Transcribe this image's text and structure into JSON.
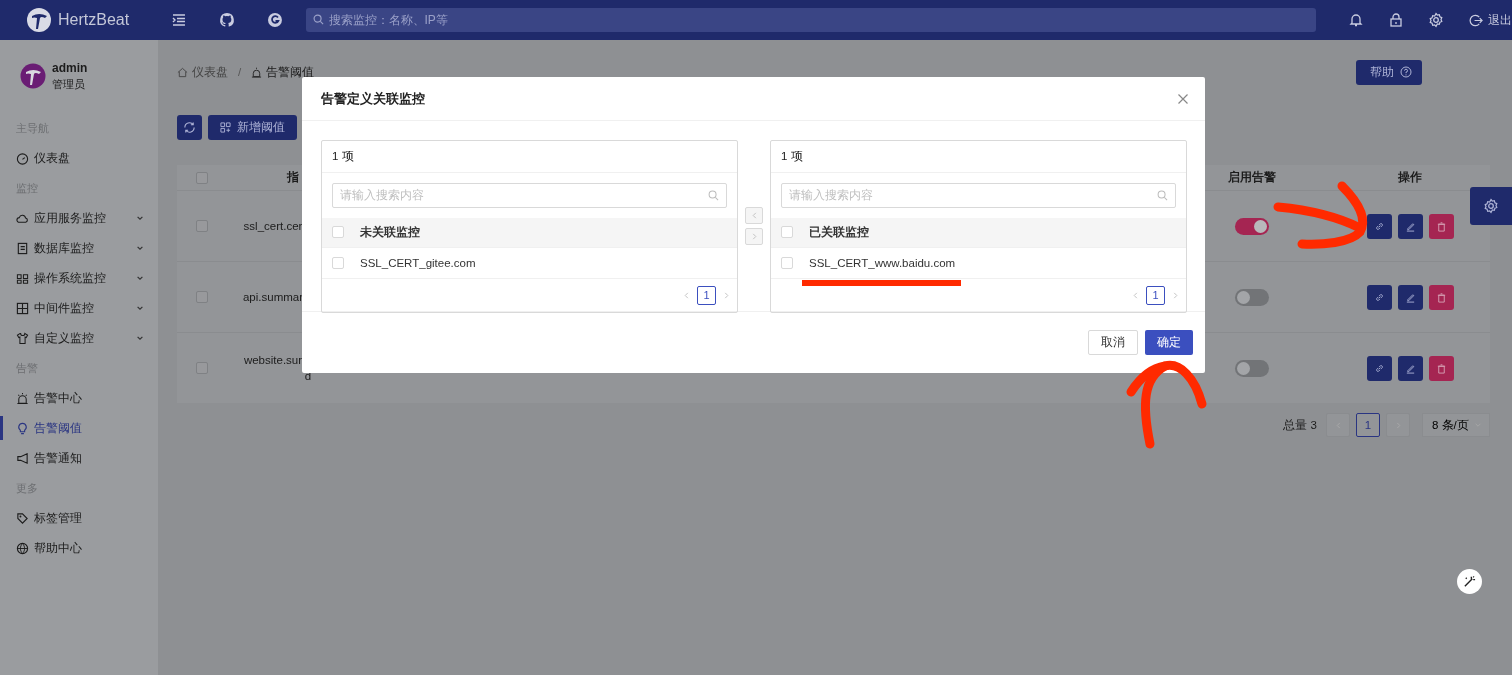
{
  "header": {
    "brand": "HertzBeat",
    "search_placeholder": "搜索监控：名称、IP等",
    "logout": "退出"
  },
  "user": {
    "name": "admin",
    "role": "管理员"
  },
  "sidebar": {
    "groups": [
      {
        "title": "主导航",
        "items": [
          {
            "label": "仪表盘",
            "expandable": false,
            "selected": false
          }
        ]
      },
      {
        "title": "监控",
        "items": [
          {
            "label": "应用服务监控",
            "expandable": true,
            "selected": false
          },
          {
            "label": "数据库监控",
            "expandable": true,
            "selected": false
          },
          {
            "label": "操作系统监控",
            "expandable": true,
            "selected": false
          },
          {
            "label": "中间件监控",
            "expandable": true,
            "selected": false
          },
          {
            "label": "自定义监控",
            "expandable": true,
            "selected": false
          }
        ]
      },
      {
        "title": "告警",
        "items": [
          {
            "label": "告警中心",
            "expandable": false,
            "selected": false
          },
          {
            "label": "告警阈值",
            "expandable": false,
            "selected": true
          },
          {
            "label": "告警通知",
            "expandable": false,
            "selected": false
          }
        ]
      },
      {
        "title": "更多",
        "items": [
          {
            "label": "标签管理",
            "expandable": false,
            "selected": false
          },
          {
            "label": "帮助中心",
            "expandable": false,
            "selected": false
          }
        ]
      }
    ]
  },
  "breadcrumb": [
    "仪表盘",
    "告警阈值"
  ],
  "breadcrumb_separator": "/",
  "help_button": "帮助",
  "toolbar": {
    "add_button": "新增阈值"
  },
  "table": {
    "columns": [
      "指",
      "启用告警",
      "操作"
    ],
    "all_checked": false,
    "rows": [
      {
        "name": [
          "ssl_cert.cer"
        ],
        "checked": false,
        "alert_enabled": true
      },
      {
        "name": [
          "api.summar"
        ],
        "checked": false,
        "alert_enabled": false
      },
      {
        "name": [
          "website.sur",
          "d"
        ],
        "checked": false,
        "alert_enabled": false
      }
    ]
  },
  "pagination": {
    "total": "总量 3",
    "page": "1",
    "page_size": "8 条/页"
  },
  "dialog": {
    "title": "告警定义关联监控",
    "panels": [
      {
        "count": "1 项",
        "search_placeholder": "请输入搜索内容",
        "list_title": "未关联监控",
        "all_checked": false,
        "items": [
          {
            "label": "SSL_CERT_gitee.com",
            "checked": false
          }
        ],
        "page": "1"
      },
      {
        "count": "1 项",
        "search_placeholder": "请输入搜索内容",
        "list_title": "已关联监控",
        "all_checked": false,
        "items": [
          {
            "label": "SSL_CERT_www.baidu.com",
            "checked": false
          }
        ],
        "page": "1"
      }
    ],
    "cancel": "取消",
    "confirm": "确定"
  }
}
